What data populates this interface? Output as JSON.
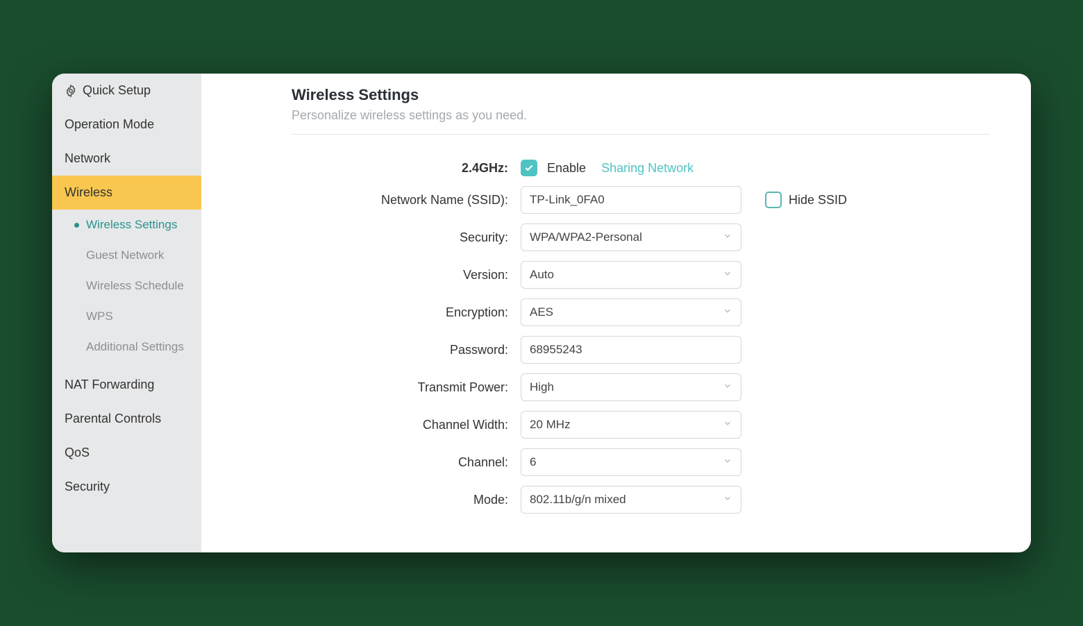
{
  "sidebar": {
    "items": [
      {
        "label": "Quick Setup",
        "icon": true
      },
      {
        "label": "Operation Mode"
      },
      {
        "label": "Network"
      },
      {
        "label": "Wireless",
        "active": true
      },
      {
        "label": "NAT Forwarding"
      },
      {
        "label": "Parental Controls"
      },
      {
        "label": "QoS"
      },
      {
        "label": "Security"
      }
    ],
    "subitems": [
      {
        "label": "Wireless Settings",
        "active": true
      },
      {
        "label": "Guest Network"
      },
      {
        "label": "Wireless Schedule"
      },
      {
        "label": "WPS"
      },
      {
        "label": "Additional Settings"
      }
    ]
  },
  "page": {
    "title": "Wireless Settings",
    "subtitle": "Personalize wireless settings as you need."
  },
  "form": {
    "band_label": "2.4GHz:",
    "enable_label": "Enable",
    "sharing_label": "Sharing Network",
    "ssid_label": "Network Name (SSID):",
    "ssid_value": "TP-Link_0FA0",
    "hide_ssid_label": "Hide SSID",
    "security_label": "Security:",
    "security_value": "WPA/WPA2-Personal",
    "version_label": "Version:",
    "version_value": "Auto",
    "encryption_label": "Encryption:",
    "encryption_value": "AES",
    "password_label": "Password:",
    "password_value": "68955243",
    "transmit_power_label": "Transmit Power:",
    "transmit_power_value": "High",
    "channel_width_label": "Channel Width:",
    "channel_width_value": "20 MHz",
    "channel_label": "Channel:",
    "channel_value": "6",
    "mode_label": "Mode:",
    "mode_value": "802.11b/g/n mixed"
  }
}
